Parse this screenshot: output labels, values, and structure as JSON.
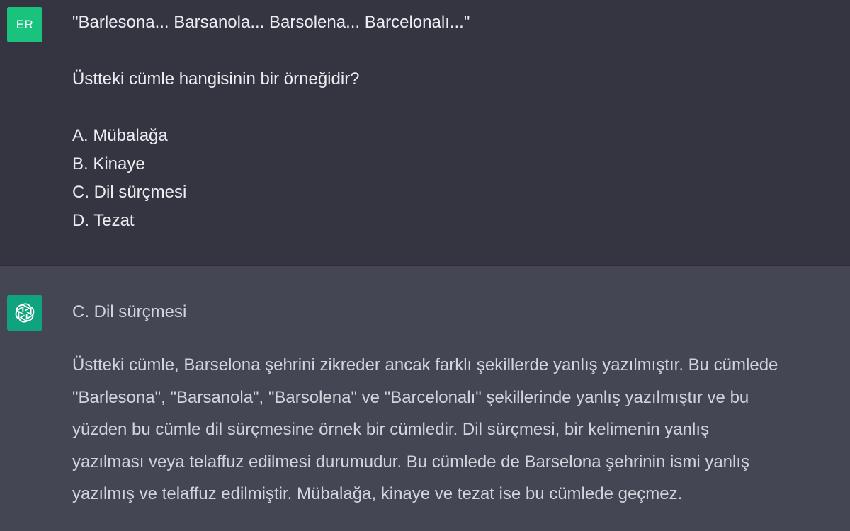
{
  "user_message": {
    "avatar_initials": "ER",
    "avatar_color": "#19c37d",
    "quote": "\"Barlesona... Barsanola... Barsolena... Barcelonalı...\"",
    "question": "Üstteki cümle hangisinin bir örneğidir?",
    "options": [
      "A. Mübalağa",
      "B. Kinaye",
      "C. Dil sürçmesi",
      "D. Tezat"
    ]
  },
  "assistant_message": {
    "avatar_icon": "openai-logo-icon",
    "avatar_color": "#10a37f",
    "answer": "C. Dil sürçmesi",
    "explanation_lines": [
      "Üstteki cümle, Barselona şehrini zikreder ancak farklı şekillerde yanlış yazılmıştır. Bu cümlede",
      "\"Barlesona\", \"Barsanola\", \"Barsolena\" ve \"Barcelonalı\" şekillerinde yanlış yazılmıştır ve bu",
      "yüzden bu cümle dil sürçmesine örnek bir cümledir. Dil sürçmesi, bir kelimenin yanlış",
      "yazılması veya telaffuz edilmesi durumudur. Bu cümlede de Barselona şehrinin ismi yanlış",
      "yazılmış ve telaffuz edilmiştir. Mübalağa, kinaye ve tezat ise bu cümlede geçmez."
    ]
  }
}
